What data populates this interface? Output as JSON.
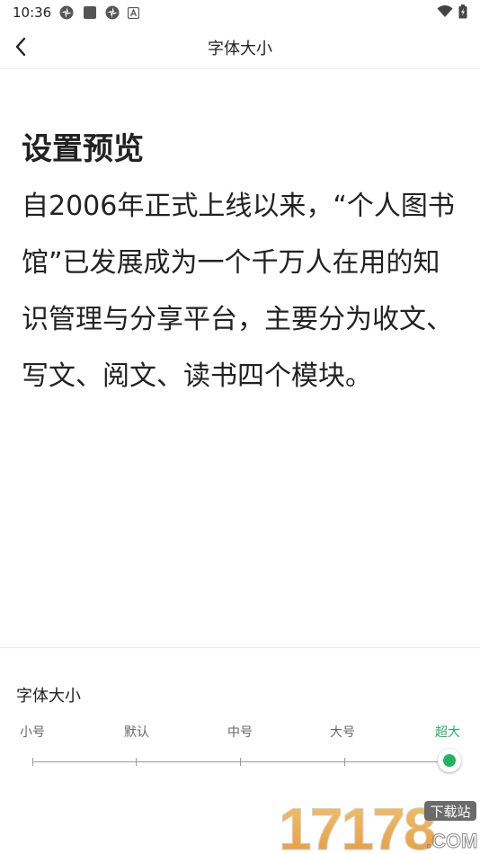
{
  "status_bar": {
    "time": "10:36",
    "left_icons": [
      "pinwheel-icon",
      "square-app-icon",
      "pinwheel-icon",
      "a-badge-icon"
    ],
    "right_icons": [
      "wifi-icon",
      "battery-charging-icon"
    ]
  },
  "top_bar": {
    "title": "字体大小",
    "back_icon": "chevron-left-icon"
  },
  "preview": {
    "heading": "设置预览",
    "body": "自2006年正式上线以来，“个人图书馆”已发展成为一个千万人在用的知识管理与分享平台，主要分为收文、写文、阅文、读书四个模块。"
  },
  "font_size_panel": {
    "label": "字体大小",
    "options": [
      "小号",
      "默认",
      "中号",
      "大号",
      "超大"
    ],
    "selected": "超大",
    "selected_index": 4,
    "accent_color": "#21b45f"
  },
  "watermark": {
    "number": "17178",
    "suffix": "下载站",
    "domain": ".COM"
  }
}
